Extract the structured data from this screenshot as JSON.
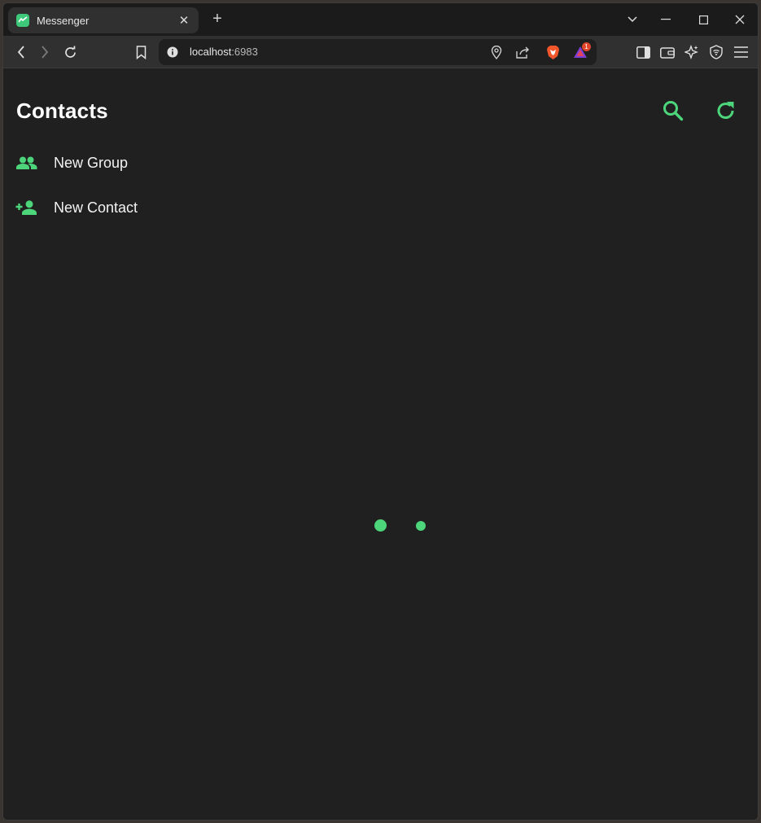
{
  "browser": {
    "tab": {
      "title": "Messenger"
    },
    "new_tab_label": "+",
    "address_bar": {
      "host": "localhost",
      "port": ":6983"
    },
    "notification_count": "1"
  },
  "page": {
    "title": "Contacts",
    "menu": [
      {
        "label": "New Group",
        "icon": "group-icon"
      },
      {
        "label": "New Contact",
        "icon": "add-person-icon"
      }
    ],
    "loading_indicator": "loading-dots"
  },
  "colors": {
    "accent": "#4cd57a",
    "background": "#202020",
    "text": "#f2f2f2"
  }
}
